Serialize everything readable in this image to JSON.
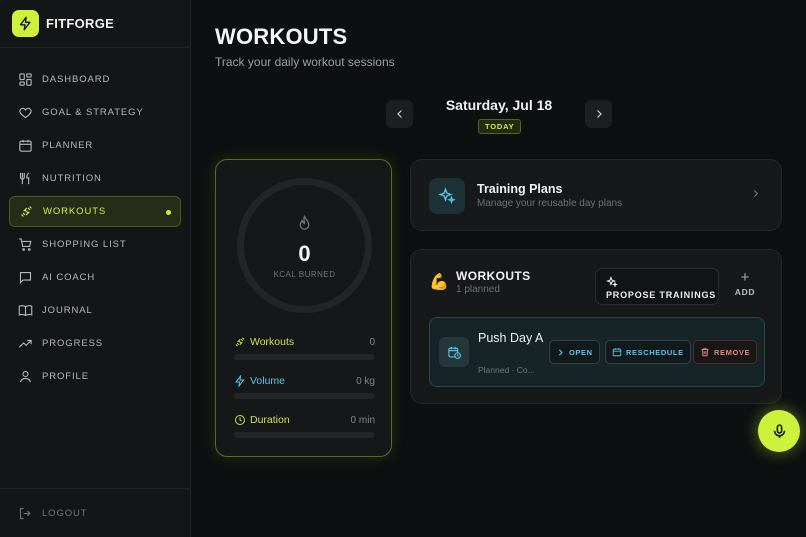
{
  "brand": {
    "name": "FITFORGE"
  },
  "sidebar": {
    "items": [
      {
        "label": "DASHBOARD"
      },
      {
        "label": "GOAL & STRATEGY"
      },
      {
        "label": "PLANNER"
      },
      {
        "label": "NUTRITION"
      },
      {
        "label": "WORKOUTS",
        "active": true
      },
      {
        "label": "SHOPPING LIST"
      },
      {
        "label": "AI COACH"
      },
      {
        "label": "JOURNAL"
      },
      {
        "label": "PROGRESS"
      },
      {
        "label": "PROFILE"
      }
    ],
    "logout": "LOGOUT"
  },
  "header": {
    "title": "WORKOUTS",
    "subtitle": "Track your daily workout sessions"
  },
  "date_nav": {
    "date": "Saturday, Jul 18",
    "badge": "TODAY"
  },
  "kcal": {
    "value": "0",
    "label": "KCAL BURNED",
    "stats": [
      {
        "label": "Workouts",
        "value": "0",
        "progress": 0
      },
      {
        "label": "Volume",
        "value": "0 kg",
        "progress": 0
      },
      {
        "label": "Duration",
        "value": "0 min",
        "progress": 0
      }
    ]
  },
  "training_plans": {
    "title": "Training Plans",
    "subtitle": "Manage your reusable day plans"
  },
  "workouts": {
    "title": "WORKOUTS",
    "subtitle": "1 planned",
    "propose_label": "PROPOSE TRAININGS",
    "add_label": "ADD",
    "sessions": [
      {
        "name": "Push Day A",
        "meta": "Planned · Co...",
        "actions": {
          "open": "OPEN",
          "reschedule": "RESCHEDULE",
          "remove": "REMOVE"
        }
      }
    ]
  },
  "colors": {
    "accent": "#cdf23b",
    "cyan": "#5cc4e8",
    "danger": "#e0877b",
    "background": "#0e0f10"
  }
}
